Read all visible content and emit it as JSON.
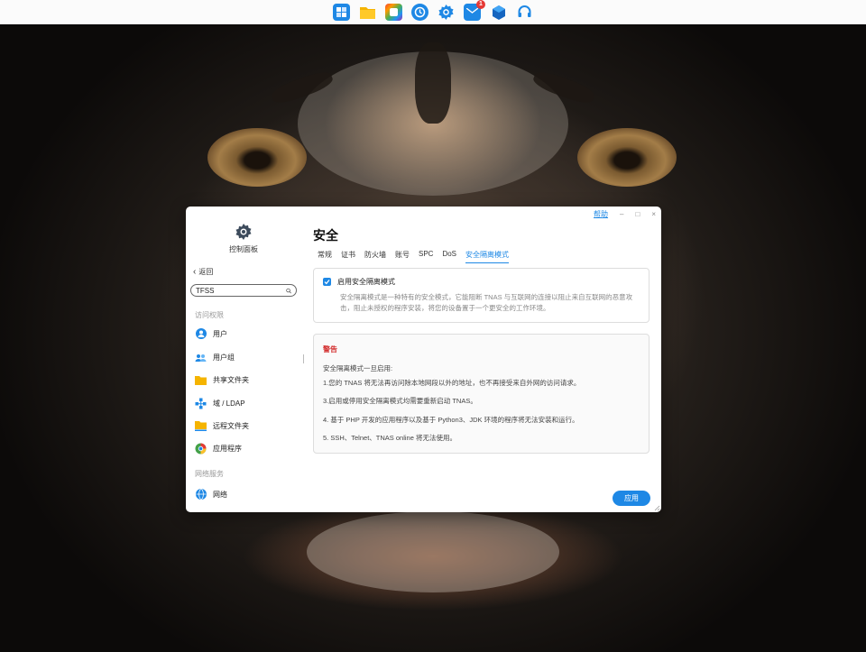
{
  "dock": {
    "icons": [
      {
        "name": "app-center-icon",
        "color": "#1e88e5"
      },
      {
        "name": "file-manager-icon",
        "color": "#f5b400"
      },
      {
        "name": "photos-icon",
        "color": "#e84393"
      },
      {
        "name": "backup-clock-icon",
        "color": "#1e88e5"
      },
      {
        "name": "control-panel-gear-icon",
        "color": "#1e88e5"
      },
      {
        "name": "mail-icon",
        "color": "#1e88e5",
        "badge": "1"
      },
      {
        "name": "security-box-icon",
        "color": "#1565c0"
      },
      {
        "name": "support-headset-icon",
        "color": "#1e88e5"
      }
    ]
  },
  "window": {
    "help_label": "帮助",
    "minimize_label": "–",
    "maximize_label": "□",
    "close_label": "×"
  },
  "sidebar": {
    "title": "控制面板",
    "back_label": "返回",
    "search_value": "TFSS",
    "section_access": "访问权限",
    "items": [
      {
        "label": "用户",
        "icon": "user-icon"
      },
      {
        "label": "用户组",
        "icon": "user-group-icon"
      },
      {
        "label": "共享文件夹",
        "icon": "shared-folder-icon"
      },
      {
        "label": "域 / LDAP",
        "icon": "domain-ldap-icon"
      },
      {
        "label": "远程文件夹",
        "icon": "remote-folder-icon"
      },
      {
        "label": "应用程序",
        "icon": "applications-icon"
      }
    ],
    "section_network": "网络服务",
    "network_items": [
      {
        "label": "网络",
        "icon": "network-icon"
      }
    ]
  },
  "main": {
    "title": "安全",
    "tabs": [
      "常规",
      "证书",
      "防火墙",
      "账号",
      "SPC",
      "DoS",
      "安全隔离模式"
    ],
    "active_tab": "安全隔离模式",
    "checkbox_label": "启用安全隔离模式",
    "checkbox_checked": true,
    "description": "安全隔离模式是一种特有的安全模式，它能阻断 TNAS 与互联网的连接以阻止来自互联网的恶意攻击，阻止未授权的程序安装，将您的设备置于一个更安全的工作环境。",
    "warning": {
      "title": "警告",
      "intro": "安全隔离模式一旦启用:",
      "lines": [
        "1.您的 TNAS 将无法再访问除本地网段以外的地址，也不再接受来自外网的访问请求。",
        "3.启用或停用安全隔离模式均需要重新启动 TNAS。",
        "4. 基于 PHP 开发的应用程序以及基于 Python3、JDK 环境的程序将无法安装和运行。",
        "5. SSH、Telnet、TNAS online 将无法使用。"
      ]
    },
    "apply_label": "应用"
  }
}
